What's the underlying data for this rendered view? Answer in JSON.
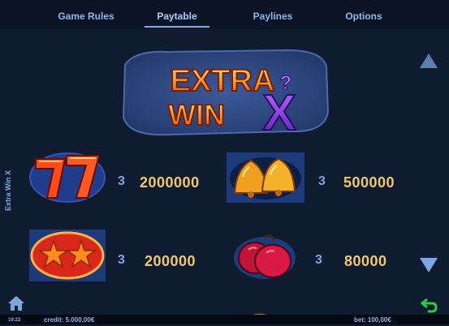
{
  "tabs": [
    {
      "label": "Game Rules",
      "active": false
    },
    {
      "label": "Paytable",
      "active": true
    },
    {
      "label": "Paylines",
      "active": false
    },
    {
      "label": "Options",
      "active": false
    }
  ],
  "game_title": "Extra Win X",
  "logo": {
    "line1": "EXTRA",
    "line2": "WIN",
    "mark": "X",
    "question": "?"
  },
  "paytable": [
    {
      "symbol": "seven-symbol",
      "count": "3",
      "payout": "2000000"
    },
    {
      "symbol": "bell-symbol",
      "count": "3",
      "payout": "500000"
    },
    {
      "symbol": "star-symbol",
      "count": "3",
      "payout": "200000"
    },
    {
      "symbol": "plum-symbol",
      "count": "3",
      "payout": "80000"
    }
  ],
  "status": {
    "time": "19:22",
    "credit": "credit: 5.000,00€",
    "bet": "bet: 100,00€"
  },
  "icons": {
    "home": "home-icon",
    "back": "back-arrow-icon",
    "up": "scroll-up-icon",
    "down": "scroll-down-icon"
  },
  "colors": {
    "accent": "#8fb6ec",
    "payout": "#f1c96a",
    "back": "#2ecc40",
    "background": "#0f1c2f"
  }
}
